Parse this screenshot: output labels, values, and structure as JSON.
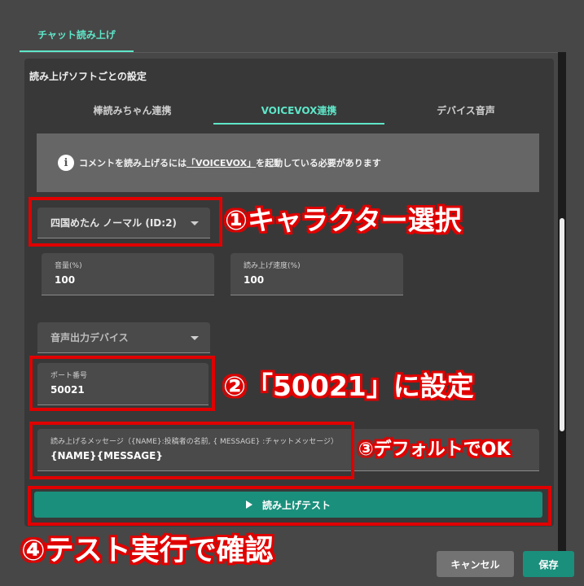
{
  "top_tab": {
    "label": "チャット読み上げ"
  },
  "section_title": "読み上げソフトごとの設定",
  "subtabs": [
    {
      "label": "棒読みちゃん連携",
      "active": false
    },
    {
      "label": "VOICEVOX連携",
      "active": true
    },
    {
      "label": "デバイス音声",
      "active": false
    }
  ],
  "notice": {
    "icon": "info-icon",
    "before": "コメントを読み上げるには",
    "link": "「VOICEVOX」",
    "after": "を起動している必要があります"
  },
  "character_select": {
    "value": "四国めたん ノーマル (ID:2)"
  },
  "volume": {
    "label": "音量(%)",
    "value": "100"
  },
  "speed": {
    "label": "読み上げ速度(%)",
    "value": "100"
  },
  "device_select": {
    "value": "音声出力デバイス"
  },
  "port": {
    "label": "ポート番号",
    "value": "50021"
  },
  "message": {
    "label": "読み上げるメッセージ（{NAME}:投稿者の名前, { MESSAGE} :チャットメッセージ）",
    "value": "{NAME}{MESSAGE}"
  },
  "test_button": {
    "label": "読み上げテスト"
  },
  "cancel_button": {
    "label": "キャンセル"
  },
  "save_button": {
    "label": "保存"
  },
  "annotations": {
    "a1": "①キャラクター選択",
    "a2": "②「50021」に設定",
    "a3": "③デフォルトでOK",
    "a4": "④テスト実行で確認"
  },
  "colors": {
    "accent": "#5ee6c8",
    "primary_button": "#1a8f7c",
    "annotation_red": "#e00000",
    "background": "#474747",
    "panel": "#383838"
  }
}
